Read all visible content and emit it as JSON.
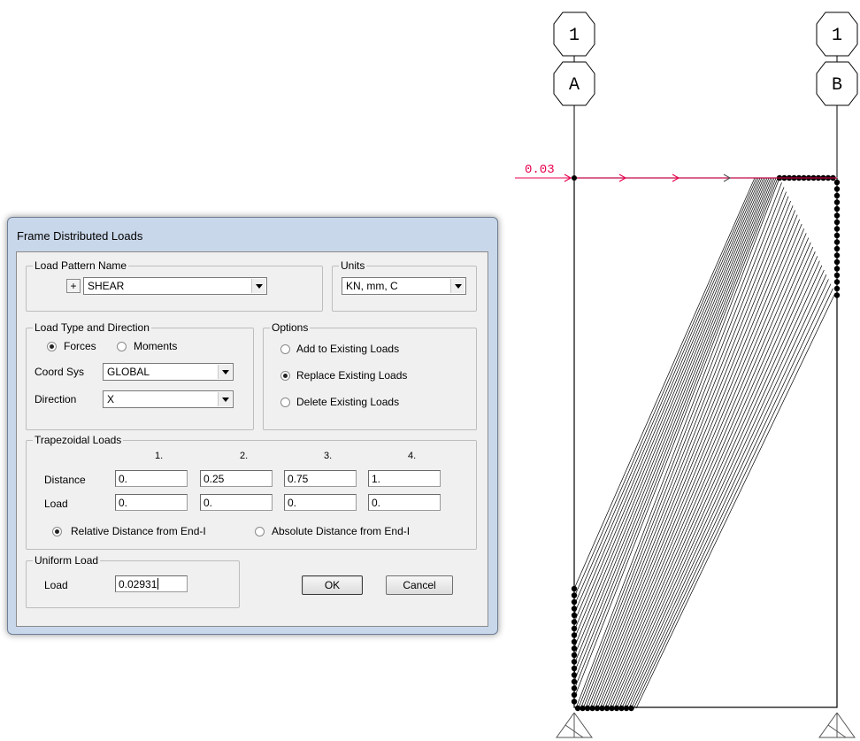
{
  "drawing": {
    "grid_bubbles": {
      "column_a": {
        "top": "1",
        "bottom": "A"
      },
      "column_b": {
        "top": "1",
        "bottom": "B"
      }
    },
    "load_label": "0.03",
    "colors": {
      "load": "#e8004c",
      "frame": "#000000",
      "hatch": "#000000"
    }
  },
  "dialog": {
    "title": "Frame Distributed Loads",
    "load_pattern": {
      "legend": "Load Pattern Name",
      "plus": "+",
      "value": "SHEAR"
    },
    "units": {
      "legend": "Units",
      "value": "KN, mm, C"
    },
    "load_type": {
      "legend": "Load Type and Direction",
      "forces": "Forces",
      "moments": "Moments",
      "selected": "Forces",
      "coord_sys_label": "Coord Sys",
      "coord_sys_value": "GLOBAL",
      "direction_label": "Direction",
      "direction_value": "X"
    },
    "options": {
      "legend": "Options",
      "add": "Add to Existing Loads",
      "replace": "Replace Existing Loads",
      "delete": "Delete Existing Loads",
      "selected": "Replace Existing Loads"
    },
    "trapezoidal": {
      "legend": "Trapezoidal Loads",
      "columns": [
        "1.",
        "2.",
        "3.",
        "4."
      ],
      "distance_label": "Distance",
      "load_label": "Load",
      "distance": [
        "0.",
        "0.25",
        "0.75",
        "1."
      ],
      "load": [
        "0.",
        "0.",
        "0.",
        "0."
      ],
      "relative": "Relative Distance from End-I",
      "absolute": "Absolute Distance from End-I",
      "selected": "Relative Distance from End-I"
    },
    "uniform": {
      "legend": "Uniform Load",
      "load_label": "Load",
      "value": "0.02931"
    },
    "ok": "OK",
    "cancel": "Cancel"
  }
}
